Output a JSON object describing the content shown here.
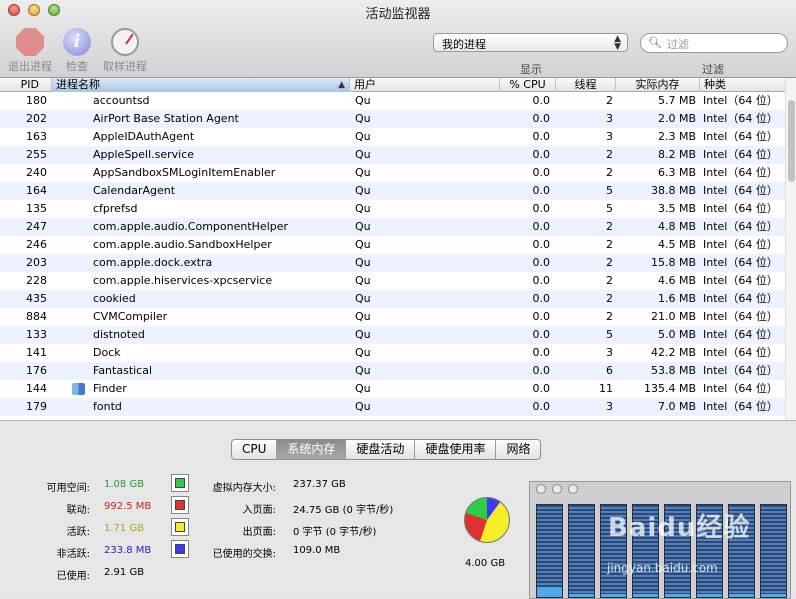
{
  "window": {
    "title": "活动监视器"
  },
  "toolbar": {
    "quit_label": "退出进程",
    "inspect_label": "检查",
    "sample_label": "取样进程",
    "show_select_value": "我的进程",
    "show_label": "显示",
    "filter_placeholder": "过滤",
    "filter_label": "过滤"
  },
  "table": {
    "headers": {
      "pid": "PID",
      "name": "进程名称",
      "user": "用户",
      "cpu": "% CPU",
      "threads": "线程",
      "mem": "实际内存",
      "kind": "种类"
    },
    "rows": [
      {
        "pid": "180",
        "name": "accountsd",
        "user": "Qu",
        "cpu": "0.0",
        "threads": "2",
        "mem": "5.7 MB",
        "kind": "Intel（64 位）"
      },
      {
        "pid": "202",
        "name": "AirPort Base Station Agent",
        "user": "Qu",
        "cpu": "0.0",
        "threads": "3",
        "mem": "2.0 MB",
        "kind": "Intel（64 位）"
      },
      {
        "pid": "163",
        "name": "AppleIDAuthAgent",
        "user": "Qu",
        "cpu": "0.0",
        "threads": "3",
        "mem": "2.3 MB",
        "kind": "Intel（64 位）"
      },
      {
        "pid": "255",
        "name": "AppleSpell.service",
        "user": "Qu",
        "cpu": "0.0",
        "threads": "2",
        "mem": "8.2 MB",
        "kind": "Intel（64 位）"
      },
      {
        "pid": "240",
        "name": "AppSandboxSMLoginItemEnabler",
        "user": "Qu",
        "cpu": "0.0",
        "threads": "2",
        "mem": "6.3 MB",
        "kind": "Intel（64 位）"
      },
      {
        "pid": "164",
        "name": "CalendarAgent",
        "user": "Qu",
        "cpu": "0.0",
        "threads": "5",
        "mem": "38.8 MB",
        "kind": "Intel（64 位）"
      },
      {
        "pid": "135",
        "name": "cfprefsd",
        "user": "Qu",
        "cpu": "0.0",
        "threads": "5",
        "mem": "3.5 MB",
        "kind": "Intel（64 位）"
      },
      {
        "pid": "247",
        "name": "com.apple.audio.ComponentHelper",
        "user": "Qu",
        "cpu": "0.0",
        "threads": "2",
        "mem": "4.8 MB",
        "kind": "Intel（64 位）"
      },
      {
        "pid": "246",
        "name": "com.apple.audio.SandboxHelper",
        "user": "Qu",
        "cpu": "0.0",
        "threads": "2",
        "mem": "4.5 MB",
        "kind": "Intel（64 位）"
      },
      {
        "pid": "203",
        "name": "com.apple.dock.extra",
        "user": "Qu",
        "cpu": "0.0",
        "threads": "2",
        "mem": "15.8 MB",
        "kind": "Intel（64 位）"
      },
      {
        "pid": "228",
        "name": "com.apple.hiservices-xpcservice",
        "user": "Qu",
        "cpu": "0.0",
        "threads": "2",
        "mem": "4.6 MB",
        "kind": "Intel（64 位）"
      },
      {
        "pid": "435",
        "name": "cookied",
        "user": "Qu",
        "cpu": "0.0",
        "threads": "2",
        "mem": "1.6 MB",
        "kind": "Intel（64 位）"
      },
      {
        "pid": "884",
        "name": "CVMCompiler",
        "user": "Qu",
        "cpu": "0.0",
        "threads": "2",
        "mem": "21.0 MB",
        "kind": "Intel（64 位）"
      },
      {
        "pid": "133",
        "name": "distnoted",
        "user": "Qu",
        "cpu": "0.0",
        "threads": "5",
        "mem": "5.0 MB",
        "kind": "Intel（64 位）"
      },
      {
        "pid": "141",
        "name": "Dock",
        "user": "Qu",
        "cpu": "0.0",
        "threads": "3",
        "mem": "42.2 MB",
        "kind": "Intel（64 位）"
      },
      {
        "pid": "176",
        "name": "Fantastical",
        "user": "Qu",
        "cpu": "0.0",
        "threads": "6",
        "mem": "53.8 MB",
        "kind": "Intel（64 位）"
      },
      {
        "pid": "144",
        "name": "Finder",
        "user": "Qu",
        "cpu": "0.0",
        "threads": "11",
        "mem": "135.4 MB",
        "kind": "Intel（64 位）",
        "icon": "finder-icon"
      },
      {
        "pid": "179",
        "name": "fontd",
        "user": "Qu",
        "cpu": "0.0",
        "threads": "3",
        "mem": "7.0 MB",
        "kind": "Intel（64 位）"
      }
    ]
  },
  "tabs": [
    {
      "label": "CPU",
      "active": false
    },
    {
      "label": "系统内存",
      "active": true
    },
    {
      "label": "硬盘活动",
      "active": false
    },
    {
      "label": "硬盘使用率",
      "active": false
    },
    {
      "label": "网络",
      "active": false
    }
  ],
  "memory": {
    "free_label": "可用空间:",
    "free_value": "1.08 GB",
    "free_color": "#2fcc45",
    "wired_label": "联动:",
    "wired_value": "992.5 MB",
    "wired_color": "#e23030",
    "active_label": "活跃:",
    "active_value": "1.71 GB",
    "active_color": "#f2ee2a",
    "inactive_label": "非活跃:",
    "inactive_value": "233.8 MB",
    "inactive_color": "#3a3af0",
    "used_label": "已使用:",
    "used_value": "2.91 GB",
    "vm_label": "虚拟内存大小:",
    "vm_value": "237.37 GB",
    "pagein_label": "入页面:",
    "pagein_value": "24.75 GB (0 字节/秒)",
    "pageout_label": "出页面:",
    "pageout_value": "0 字节 (0 字节/秒)",
    "swap_label": "已使用的交换:",
    "swap_value": "109.0 MB",
    "total_label": "4.00 GB"
  },
  "watermark": {
    "text": "Baidu经验",
    "url_text": "jingyan.baidu.com"
  }
}
